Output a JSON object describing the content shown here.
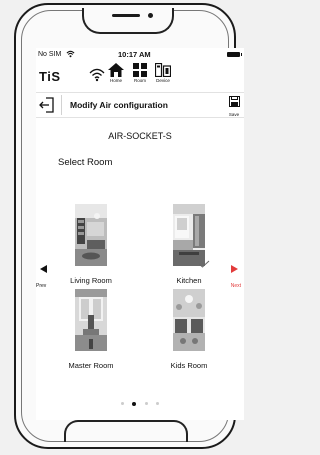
{
  "status_bar": {
    "carrier": "No SIM",
    "time": "10:17 AM"
  },
  "top_nav": {
    "logo": "TiS",
    "items": [
      {
        "label": "Home",
        "icon": "home-icon"
      },
      {
        "label": "Room",
        "icon": "grid-icon"
      },
      {
        "label": "Device",
        "icon": "device-icon"
      }
    ]
  },
  "header": {
    "title": "Modify Air configuration",
    "save_label": "Save"
  },
  "device_name": "AIR-SOCKET-S",
  "select_room_label": "Select Room",
  "rooms": [
    {
      "name": "Living Room",
      "selected": false
    },
    {
      "name": "Kitchen",
      "selected": true
    },
    {
      "name": "Master Room",
      "selected": false
    },
    {
      "name": "Kids Room",
      "selected": false
    }
  ],
  "pager": {
    "prev_label": "Prev",
    "next_label": "Next",
    "page_count": 4,
    "current_page": 2
  },
  "colors": {
    "accent_next": "#e23b3b",
    "text": "#111111"
  }
}
